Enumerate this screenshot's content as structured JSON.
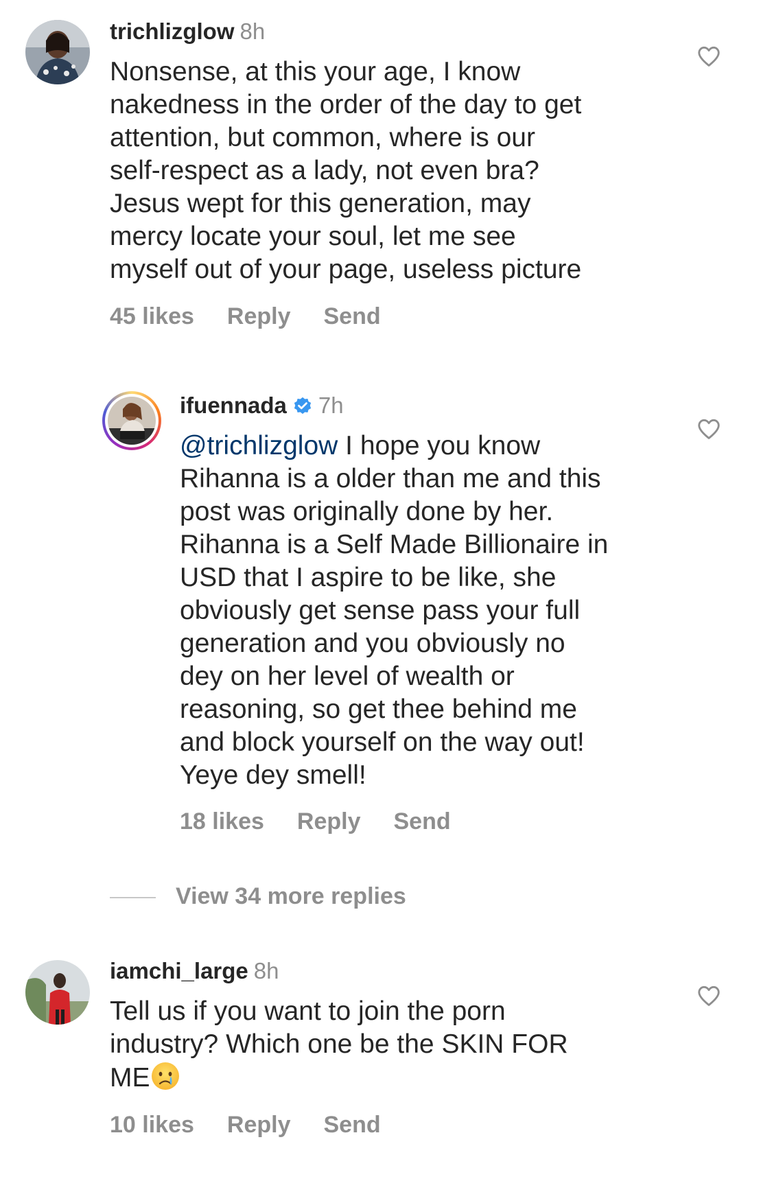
{
  "comments": [
    {
      "username": "trichlizglow",
      "time": "8h",
      "lines": [
        "Nonsense,  at this your age,  I know",
        "nakedness in the order of the day to get",
        "attention, but common,  where is our",
        "self-respect as a lady, not even bra?",
        "Jesus wept for this generation, may",
        "mercy locate your soul, let me see",
        "myself out of your page, useless picture"
      ],
      "likes": "45 likes",
      "reply": "Reply",
      "send": "Send"
    },
    {
      "username": "ifuennada",
      "time": "7h",
      "mention": "@trichlizglow",
      "first_line_rest": " I hope you know",
      "lines": [
        "Rihanna is a older than me and this",
        "post was originally done by her.",
        "Rihanna is a Self Made Billionaire in",
        "USD that I aspire to be like, she",
        "obviously get sense pass your full",
        "generation and you obviously no",
        "dey on her level of wealth or",
        "reasoning, so get thee behind me",
        "and block yourself on the way out!",
        "Yeye dey smell!"
      ],
      "likes": "18 likes",
      "reply": "Reply",
      "send": "Send"
    },
    {
      "username": "iamchi_large",
      "time": "8h",
      "lines": [
        "Tell us if you want to join the porn",
        "industry? Which one be the SKIN FOR",
        "ME"
      ],
      "likes": "10 likes",
      "reply": "Reply",
      "send": "Send"
    }
  ],
  "view_replies": "View 34 more replies",
  "icons": {
    "like": "heart-outline-icon",
    "verified": "verified-badge-icon",
    "emoji": "crying-face-emoji"
  },
  "colors": {
    "text": "#262626",
    "secondary": "#8e8e8e",
    "mention": "#00376b",
    "verified": "#3897f0"
  }
}
